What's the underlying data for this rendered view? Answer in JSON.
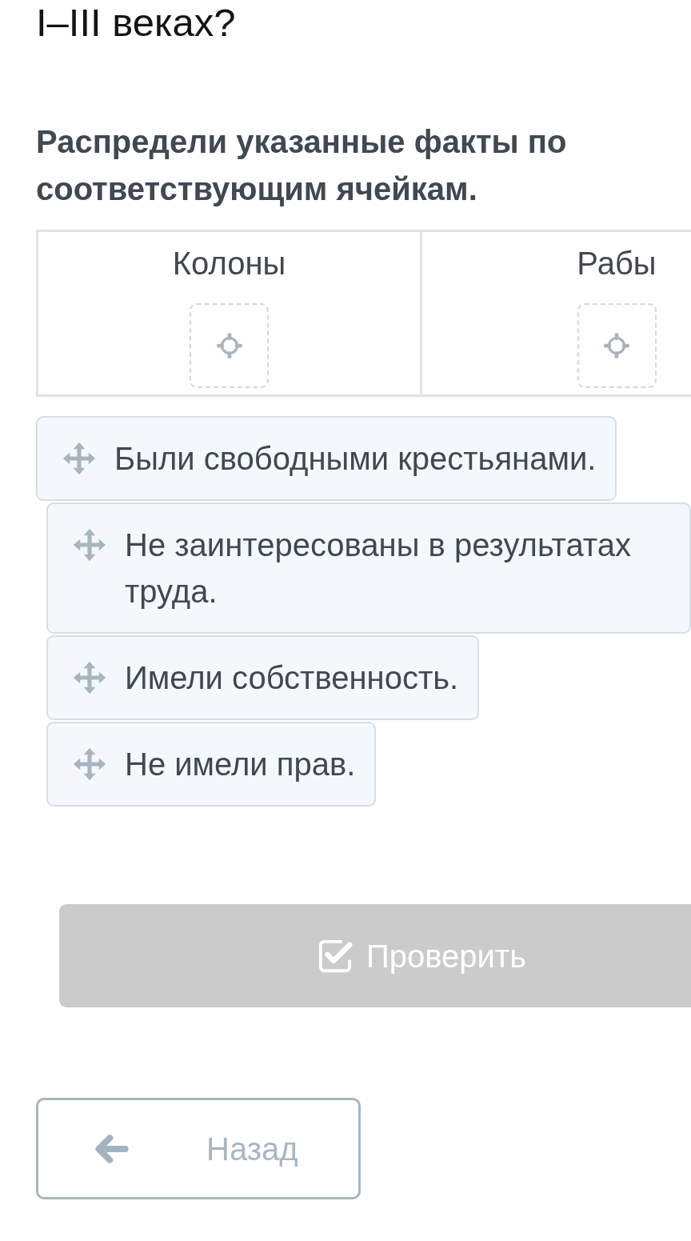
{
  "question": {
    "title": "I–III веках?"
  },
  "task": {
    "instruction": "Распредели указанные факты по соответствующим ячейкам."
  },
  "table": {
    "columns": [
      {
        "heading": "Колоны"
      },
      {
        "heading": "Рабы"
      }
    ]
  },
  "facts": [
    {
      "text": "Были свободными крестьянами."
    },
    {
      "text": "Не заинтересованы в результатах труда."
    },
    {
      "text": "Имели собственность."
    },
    {
      "text": "Не имели прав."
    }
  ],
  "check_button": {
    "label": "Проверить",
    "disabled": true
  },
  "back_button": {
    "label": "Назад"
  }
}
